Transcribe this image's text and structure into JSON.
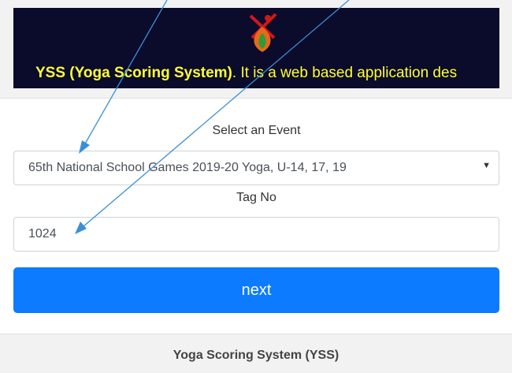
{
  "banner": {
    "title_bold": "YSS (Yoga Scoring System)",
    "title_rest": ". It is a web based application des",
    "logo_icon": "yoga-leaf-logo-icon",
    "background_color": "#0b0b2b",
    "text_color": "#ffff33"
  },
  "form": {
    "event_label": "Select an Event",
    "event_selected": "65th National School Games 2019-20 Yoga, U-14, 17, 19",
    "tag_label": "Tag No",
    "tag_value": "1024",
    "next_label": "next",
    "button_color": "#0d7bff"
  },
  "footer": {
    "text": "Yoga Scoring System (YSS)"
  },
  "annotations": {
    "arrow_color": "#3b8fd6"
  }
}
